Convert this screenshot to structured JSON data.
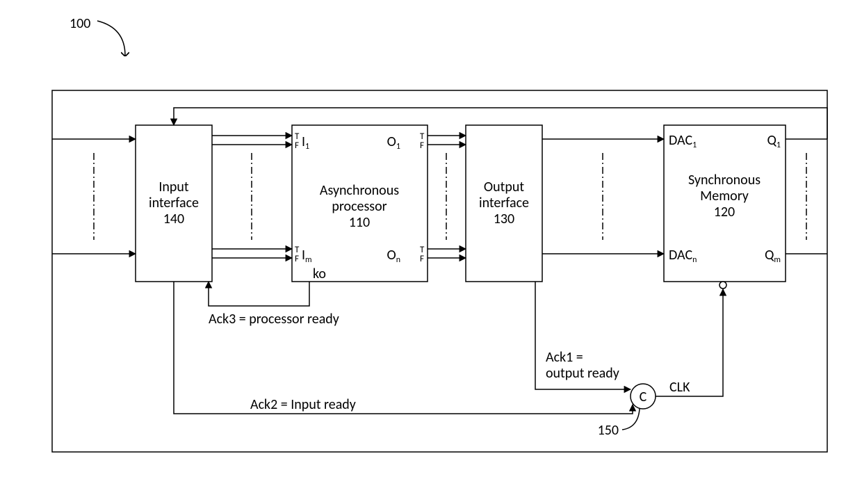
{
  "figure_ref": "100",
  "outer_box": true,
  "blocks": {
    "input_if": {
      "title_l1": "Input",
      "title_l2": "interface",
      "ref": "140"
    },
    "proc": {
      "title_l1": "Asynchronous",
      "title_l2": "processor",
      "ref": "110",
      "ports": {
        "in_top_T": "T",
        "in_top_F": "F",
        "in_top_lbl": "I",
        "in_top_sub": "1",
        "in_bot_T": "T",
        "in_bot_F": "F",
        "in_bot_lbl": "I",
        "in_bot_sub": "m",
        "out_top_lbl": "O",
        "out_top_sub": "1",
        "out_top_T": "T",
        "out_top_F": "F",
        "out_bot_lbl": "O",
        "out_bot_sub": "n",
        "out_bot_T": "T",
        "out_bot_F": "F",
        "ko": "ko"
      }
    },
    "output_if": {
      "title_l1": "Output",
      "title_l2": "interface",
      "ref": "130"
    },
    "memory": {
      "title_l1": "Synchronous",
      "title_l2": "Memory",
      "ref": "120",
      "ports": {
        "dac_top": "DAC",
        "dac_top_sub": "1",
        "dac_bot": "DAC",
        "dac_bot_sub": "n",
        "q_top": "Q",
        "q_top_sub": "1",
        "q_bot": "Q",
        "q_bot_sub": "m"
      }
    }
  },
  "c_element": {
    "label": "C",
    "ref": "150"
  },
  "signals": {
    "ack3": "Ack3 = processor ready",
    "ack2": "Ack2 = Input ready",
    "ack1_l1": "Ack1 =",
    "ack1_l2": "output ready",
    "clk": "CLK"
  }
}
